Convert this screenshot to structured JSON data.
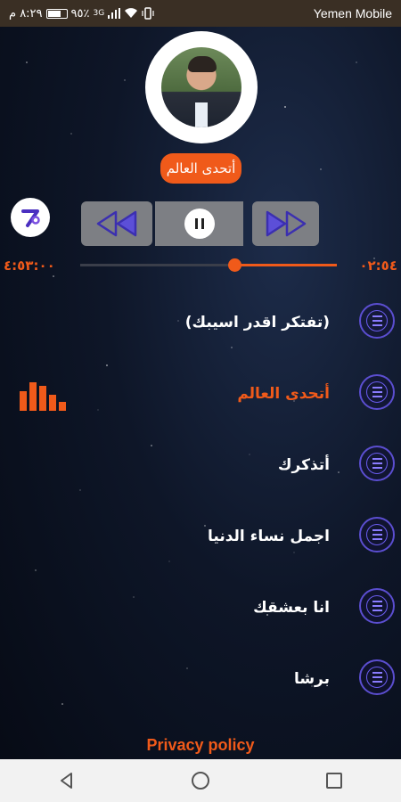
{
  "status_bar": {
    "time": "٨:٢٩ م",
    "battery": "٩٥٪",
    "network": "3G",
    "carrier": "Yemen Mobile"
  },
  "player": {
    "now_playing": "أتحدى العالم",
    "elapsed": "٠٢:٥٤",
    "total": "٤:٥٣:٠٠",
    "progress": 0.4
  },
  "songs": [
    {
      "title": "(تفتكر اقدر اسيبك)",
      "active": false
    },
    {
      "title": "أتحدى العالم",
      "active": true
    },
    {
      "title": "أتذكرك",
      "active": false
    },
    {
      "title": "اجمل نساء الدنيا",
      "active": false
    },
    {
      "title": "انا بعشقك",
      "active": false
    },
    {
      "title": "برشا",
      "active": false
    }
  ],
  "footer": {
    "privacy_label": "Privacy policy"
  },
  "colors": {
    "accent": "#f05a1a",
    "status_bar": "#3a2f24",
    "control_bg": "#7d7f84",
    "menu_ring": "#5b4ed0"
  },
  "icons": {
    "prev": "rewind-icon",
    "play_pause": "pause-icon",
    "next": "forward-icon",
    "song_menu": "menu-icon",
    "equalizer": "equalizer-icon",
    "logo": "app-logo-icon"
  }
}
